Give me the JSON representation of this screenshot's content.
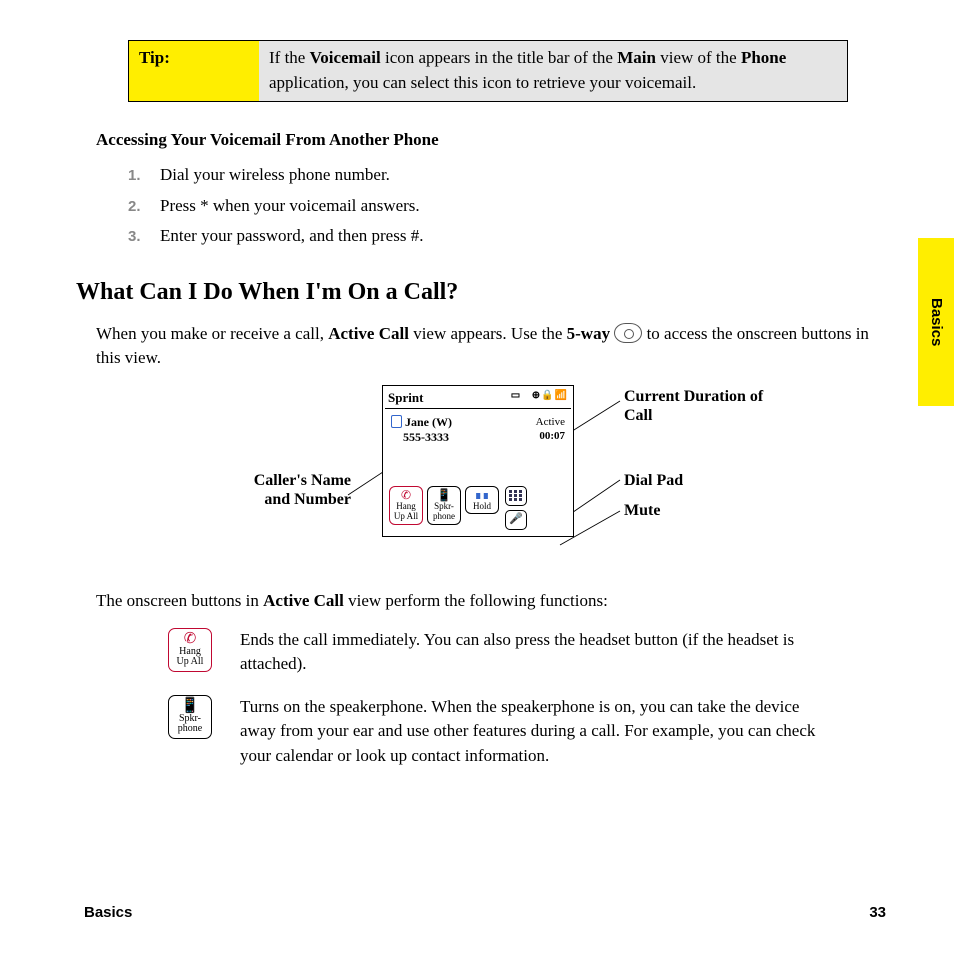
{
  "tip": {
    "label": "Tip:",
    "text_parts": [
      "If the ",
      "Voicemail",
      " icon appears in the title bar of the ",
      "Main",
      " view of the ",
      "Phone",
      " application, you can select this icon to retrieve your voicemail."
    ]
  },
  "section1_heading": "Accessing Your Voicemail From Another Phone",
  "steps": [
    "Dial your wireless phone number.",
    "Press * when your voicemail answers.",
    "Enter your password, and then press #."
  ],
  "heading2": "What Can I Do When I'm On a Call?",
  "intro_parts": [
    "When you make or receive a call, ",
    "Active Call",
    " view appears. Use the ",
    "5-way",
    " ",
    " to access the onscreen buttons in this view."
  ],
  "diagram": {
    "phone_title": "Sprint",
    "caller_name": "Jane (W)",
    "caller_number": "555-3333",
    "status": "Active",
    "duration": "00:07",
    "btn_hang": "Hang Up All",
    "btn_spkr": "Spkr- phone",
    "btn_hold": "Hold",
    "callouts": {
      "caller": "Caller's Name and Number",
      "duration": "Current Duration of Call",
      "dialpad": "Dial Pad",
      "mute": "Mute"
    }
  },
  "functions_intro_parts": [
    "The onscreen buttons in ",
    "Active Call",
    " view perform the following functions:"
  ],
  "functions": [
    {
      "icon_label": "Hang Up All",
      "text": "Ends the call immediately. You can also press the headset button (if the headset is attached)."
    },
    {
      "icon_label": "Spkr- phone",
      "text": "Turns on the speakerphone. When the speakerphone is on, you can take the device away from your ear and use other features during a call. For example, you can check your calendar or look up contact information."
    }
  ],
  "side_tab": "Basics",
  "footer_left": "Basics",
  "footer_right": "33"
}
